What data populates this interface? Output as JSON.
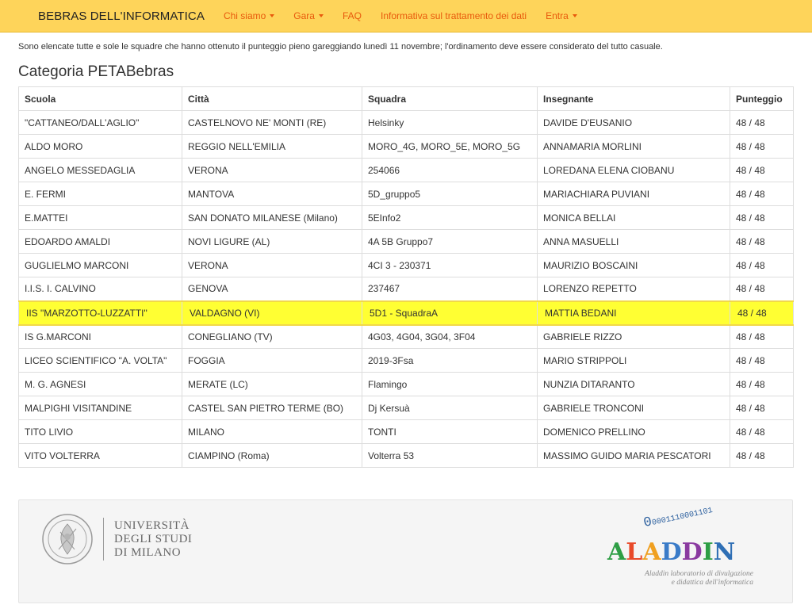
{
  "navbar": {
    "brand": "BEBRAS DELL'INFORMATICA",
    "items": [
      {
        "label": "Chi siamo",
        "dropdown": true
      },
      {
        "label": "Gara",
        "dropdown": true
      },
      {
        "label": "FAQ",
        "dropdown": false
      },
      {
        "label": "Informativa sul trattamento dei dati",
        "dropdown": false
      },
      {
        "label": "Entra",
        "dropdown": true
      }
    ]
  },
  "intro": "Sono elencate tutte e sole le squadre che hanno ottenuto il punteggio pieno gareggiando lunedì 11 novembre; l'ordinamento deve essere considerato del tutto casuale.",
  "category_title": "Categoria PETABebras",
  "table": {
    "headers": [
      "Scuola",
      "Città",
      "Squadra",
      "Insegnante",
      "Punteggio"
    ],
    "rows": [
      [
        "\"CATTANEO/DALL'AGLIO\"",
        "CASTELNOVO NE' MONTI (RE)",
        "Helsinky",
        "DAVIDE D'EUSANIO",
        "48 / 48"
      ],
      [
        "ALDO MORO",
        "REGGIO NELL'EMILIA",
        "MORO_4G, MORO_5E, MORO_5G",
        "ANNAMARIA MORLINI",
        "48 / 48"
      ],
      [
        "ANGELO MESSEDAGLIA",
        "VERONA",
        "254066",
        "LOREDANA ELENA CIOBANU",
        "48 / 48"
      ],
      [
        "E. FERMI",
        "MANTOVA",
        "5D_gruppo5",
        "MARIACHIARA PUVIANI",
        "48 / 48"
      ],
      [
        "E.MATTEI",
        "SAN DONATO MILANESE (Milano)",
        "5EInfo2",
        "MONICA BELLAI",
        "48 / 48"
      ],
      [
        "EDOARDO AMALDI",
        "NOVI LIGURE (AL)",
        "4A 5B Gruppo7",
        "ANNA MASUELLI",
        "48 / 48"
      ],
      [
        "GUGLIELMO MARCONI",
        "VERONA",
        "4CI 3 - 230371",
        "MAURIZIO BOSCAINI",
        "48 / 48"
      ],
      [
        "I.I.S. I. CALVINO",
        "GENOVA",
        "237467",
        "LORENZO REPETTO",
        "48 / 48"
      ],
      [
        "IIS \"MARZOTTO-LUZZATTI\"",
        "VALDAGNO (VI)",
        "5D1 - SquadraA",
        "MATTIA BEDANI",
        "48 / 48"
      ],
      [
        "IS G.MARCONI",
        "CONEGLIANO (TV)",
        "4G03, 4G04, 3G04, 3F04",
        "GABRIELE RIZZO",
        "48 / 48"
      ],
      [
        "LICEO SCIENTIFICO \"A. VOLTA\"",
        "FOGGIA",
        "2019-3Fsa",
        "MARIO STRIPPOLI",
        "48 / 48"
      ],
      [
        "M. G. AGNESI",
        "MERATE (LC)",
        "Flamingo",
        "NUNZIA DITARANTO",
        "48 / 48"
      ],
      [
        "MALPIGHI VISITANDINE",
        "CASTEL SAN PIETRO TERME (BO)",
        "Dj Kersuà",
        "GABRIELE TRONCONI",
        "48 / 48"
      ],
      [
        "TITO LIVIO",
        "MILANO",
        "TONTI",
        "DOMENICO PRELLINO",
        "48 / 48"
      ],
      [
        "VITO VOLTERRA",
        "CIAMPINO (Roma)",
        "Volterra 53",
        "MASSIMO GUIDO MARIA PESCATORI",
        "48 / 48"
      ]
    ],
    "highlighted_row": 8
  },
  "footer": {
    "unimi_lines": [
      "UNIVERSITÀ",
      "DEGLI STUDI",
      "DI MILANO"
    ],
    "aladdin_bits_lead": "0",
    "aladdin_bits": "0001110001101",
    "aladdin_word": "ALADDIN",
    "aladdin_letter_colors": [
      "#2e9e45",
      "#e84a2a",
      "#f0a020",
      "#3a7bc8",
      "#8a3aa0",
      "#2e9e45",
      "#2f6fb5"
    ],
    "aladdin_tagline_1": "Aladdin laboratorio di divulgazione",
    "aladdin_tagline_2": "e didattica dell'informatica"
  },
  "colors": {
    "navbar_bg": "#fed45a",
    "nav_link": "#e8590c",
    "highlight_row": "#ffff33"
  },
  "icons": [
    "caret-down-icon",
    "university-seal-logo",
    "aladdin-logo"
  ]
}
